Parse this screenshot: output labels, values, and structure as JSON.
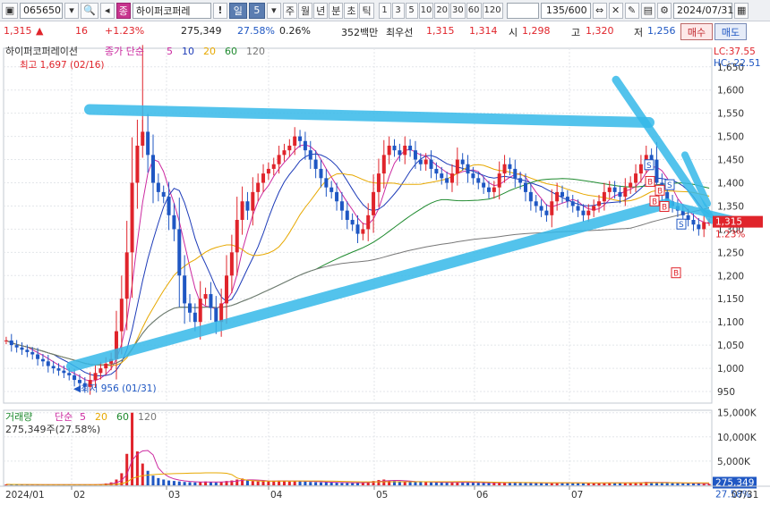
{
  "toolbar": {
    "code": "065650",
    "badge": "종",
    "name": "하이퍼코퍼레",
    "excl": "!",
    "period_selected": "일",
    "period_value": "5",
    "periods": [
      "주",
      "월",
      "년",
      "분",
      "초",
      "틱"
    ],
    "tick_values": [
      "1",
      "3",
      "5",
      "10",
      "20",
      "30",
      "60",
      "120"
    ],
    "count": "135/600",
    "date": "2024/07/31"
  },
  "quote": {
    "price": "1,315",
    "change": "16",
    "change_pct": "+1.23%",
    "volume": "275,349",
    "volume_ratio": "27.58%",
    "turnover_ratio": "0.26%",
    "amount": "352백만",
    "best_ask_label": "최우선",
    "best_ask": "1,315",
    "best_bid": "1,314",
    "open_label": "시",
    "open": "1,298",
    "high_label": "고",
    "high": "1,320",
    "low_label": "저",
    "low": "1,256",
    "buy_label": "매수",
    "sell_label": "매도"
  },
  "price_panel": {
    "title": "하이퍼코퍼레이션",
    "ma_label": "종가 단순",
    "ma_periods": [
      "5",
      "10",
      "20",
      "60",
      "120"
    ],
    "ma_colors": [
      "#cc2aa0",
      "#1d3bb8",
      "#e7a800",
      "#1e8a2e",
      "#777777"
    ],
    "lc": "LC:37.55",
    "hc": "HC:-22.51",
    "high_note": "최고 1,697 (02/16)",
    "low_note": "최저 956 (01/31)",
    "current_price": "1,315",
    "current_pct": "1.23%",
    "yticks": [
      "1,650",
      "1,600",
      "1,550",
      "1,500",
      "1,450",
      "1,400",
      "1,350",
      "1,300",
      "1,250",
      "1,200",
      "1,150",
      "1,100",
      "1,050",
      "1,000",
      "950"
    ]
  },
  "volume_panel": {
    "title": "거래량",
    "ma_label": "단순",
    "ma_periods": [
      "5",
      "20",
      "60",
      "120"
    ],
    "value_note": "275,349주(27.58%)",
    "yticks": [
      "15,000K",
      "10,000K",
      "5,000K"
    ],
    "current_volume": "275,349",
    "current_pct": "27.58%"
  },
  "xaxis": {
    "labels": [
      "2024/01",
      "02",
      "03",
      "04",
      "05",
      "06",
      "07"
    ],
    "end_label": "07/31"
  },
  "signals": [
    "S",
    "B",
    "B",
    "S",
    "B",
    "B",
    "S",
    "B"
  ],
  "chart_data": {
    "type": "candlestick",
    "x_range": [
      "2024/01",
      "2024/07/31"
    ],
    "ylim": [
      925,
      1690
    ],
    "max": {
      "label": "최고 1,697 (02/16)",
      "value": 1697
    },
    "min": {
      "label": "최저 956 (01/31)",
      "value": 956
    },
    "close_series": [
      1060,
      1050,
      1045,
      1040,
      1035,
      1030,
      1020,
      1015,
      1005,
      1000,
      995,
      990,
      985,
      975,
      968,
      960,
      975,
      990,
      1000,
      1010,
      1020,
      1080,
      1150,
      1250,
      1400,
      1480,
      1510,
      1460,
      1400,
      1380,
      1370,
      1330,
      1300,
      1200,
      1140,
      1120,
      1100,
      1150,
      1160,
      1130,
      1100,
      1140,
      1200,
      1250,
      1320,
      1360,
      1340,
      1380,
      1400,
      1420,
      1430,
      1440,
      1460,
      1470,
      1480,
      1500,
      1490,
      1470,
      1450,
      1430,
      1410,
      1390,
      1380,
      1360,
      1340,
      1320,
      1310,
      1290,
      1300,
      1330,
      1380,
      1420,
      1460,
      1480,
      1470,
      1460,
      1480,
      1470,
      1450,
      1440,
      1450,
      1430,
      1420,
      1410,
      1400,
      1420,
      1450,
      1440,
      1420,
      1410,
      1400,
      1390,
      1380,
      1390,
      1420,
      1440,
      1430,
      1410,
      1400,
      1380,
      1360,
      1350,
      1340,
      1330,
      1360,
      1380,
      1370,
      1360,
      1350,
      1340,
      1330,
      1340,
      1350,
      1360,
      1380,
      1390,
      1380,
      1370,
      1390,
      1400,
      1420,
      1440,
      1460,
      1450,
      1400,
      1380,
      1360,
      1350,
      1340,
      1330,
      1320,
      1310,
      1300,
      1315,
      1315
    ],
    "volume_series_k": [
      200,
      180,
      160,
      150,
      140,
      150,
      130,
      120,
      110,
      120,
      140,
      130,
      120,
      110,
      130,
      160,
      180,
      200,
      260,
      400,
      600,
      1200,
      2500,
      6500,
      15000,
      7000,
      4500,
      3000,
      2000,
      1500,
      1200,
      1000,
      900,
      800,
      700,
      650,
      600,
      700,
      800,
      700,
      600,
      700,
      900,
      1000,
      1200,
      1400,
      1100,
      900,
      800,
      850,
      900,
      950,
      1000,
      900,
      800,
      850,
      900,
      800,
      700,
      650,
      600,
      650,
      600,
      550,
      500,
      520,
      540,
      560,
      600,
      700,
      900,
      1100,
      1200,
      1000,
      900,
      850,
      800,
      750,
      700,
      680,
      650,
      620,
      600,
      580,
      560,
      600,
      650,
      600,
      580,
      560,
      540,
      520,
      500,
      520,
      560,
      600,
      580,
      560,
      540,
      520,
      500,
      480,
      460,
      450,
      500,
      540,
      520,
      500,
      480,
      460,
      450,
      460,
      480,
      500,
      520,
      540,
      520,
      500,
      520,
      540,
      560,
      600,
      700,
      650,
      560,
      520,
      500,
      480,
      460,
      440,
      420,
      400,
      380,
      300,
      275
    ],
    "annotations": [
      "최고 1,697 (02/16)",
      "최저 956 (01/31)",
      "LC:37.55",
      "HC:-22.51"
    ]
  }
}
